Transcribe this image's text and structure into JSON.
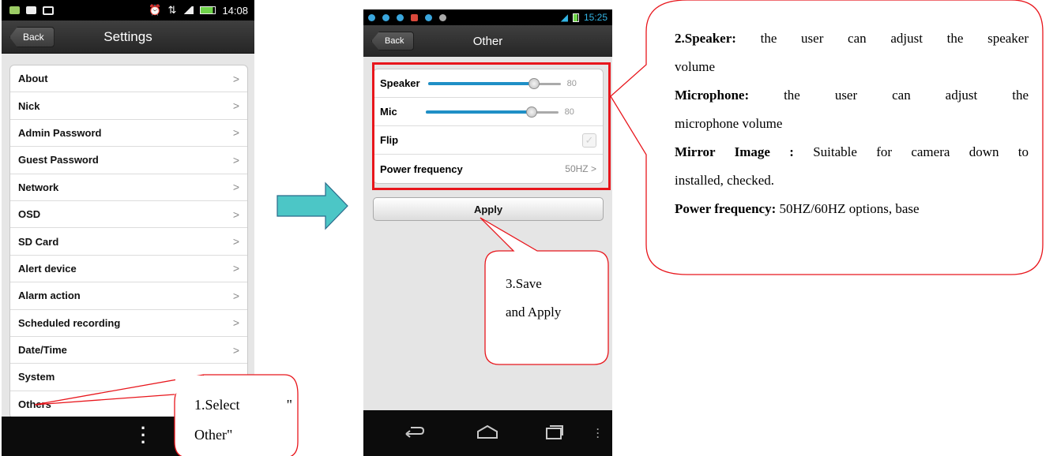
{
  "phone1": {
    "status_time": "14:08",
    "back_label": "Back",
    "title": "Settings",
    "items": [
      "About",
      "Nick",
      "Admin Password",
      "Guest Password",
      "Network",
      "OSD",
      "SD Card",
      "Alert device",
      "Alarm action",
      "Scheduled recording",
      "Date/Time",
      "System",
      "Others"
    ],
    "chevron": ">"
  },
  "phone2": {
    "status_time": "15:25",
    "back_label": "Back",
    "title": "Other",
    "speaker_label": "Speaker",
    "speaker_value": "80",
    "speaker_level": 0.8,
    "mic_label": "Mic",
    "mic_value": "80",
    "mic_level": 0.8,
    "flip_label": "Flip",
    "flip_checked": true,
    "power_label": "Power frequency",
    "power_value": "50HZ",
    "apply_label": "Apply"
  },
  "callouts": {
    "select_line1_a": "1.Select",
    "select_line1_b": "\"",
    "select_line2": "Other\"",
    "save_line1": "3.Save",
    "save_line2": "and Apply",
    "speaker_title": "2.Speaker:",
    "speaker_desc_a": " the user can adjust the speaker",
    "speaker_desc_b": "volume",
    "mic_title": "Microphone:",
    "mic_desc_a": " the user can adjust the",
    "mic_desc_b": "microphone volume",
    "mirror_title": "Mirror Image :",
    "mirror_desc_a": " Suitable for camera down to",
    "mirror_desc_b": "installed, checked.",
    "power_title": "Power frequency:",
    "power_desc": " 50HZ/60HZ options, base"
  },
  "colors": {
    "callout_border": "#e8161c",
    "arrow_fill": "#4cc6c6",
    "slider_fill": "#1f8fc6"
  }
}
